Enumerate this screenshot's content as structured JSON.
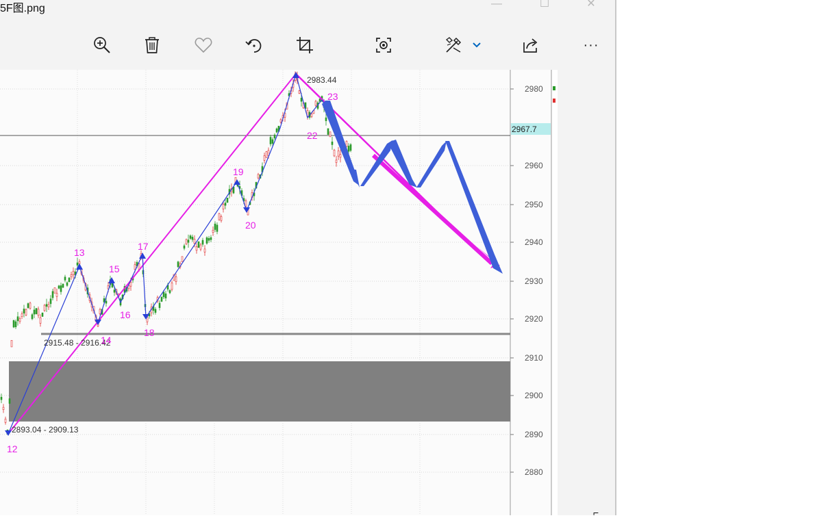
{
  "window": {
    "title": "5F图.png",
    "minimize_glyph": "—",
    "maximize_glyph": "☐",
    "close_glyph": "✕"
  },
  "toolbar": {
    "icons": [
      "zoom-in-icon",
      "delete-icon",
      "favorite-icon",
      "rotate-icon",
      "crop-icon",
      "visual-lookup-icon",
      "edit-icon",
      "share-icon",
      "more-icon"
    ],
    "more_label": "···",
    "accent": "#0067c0"
  },
  "chart": {
    "price_axis_labels": [
      "2980",
      "2960",
      "2950",
      "2940",
      "2930",
      "2920",
      "2910",
      "2900",
      "2890",
      "2880"
    ],
    "current_price_tag": "2967.7",
    "peak_label": "2983.44",
    "range_upper_label": "2915.48 - 2916.42",
    "range_lower_label": "2893.04 - 2909.13",
    "wave_labels": [
      "12",
      "13",
      "14",
      "15",
      "16",
      "17",
      "18",
      "19",
      "20",
      "22",
      "23"
    ],
    "colors": {
      "magenta": "#e61fe6",
      "blue_trend": "#2a3fd6",
      "projection": "#3e5fd8",
      "up_candle": "#e03030",
      "down_candle": "#2a9a2a",
      "zone": "#808080"
    }
  }
}
